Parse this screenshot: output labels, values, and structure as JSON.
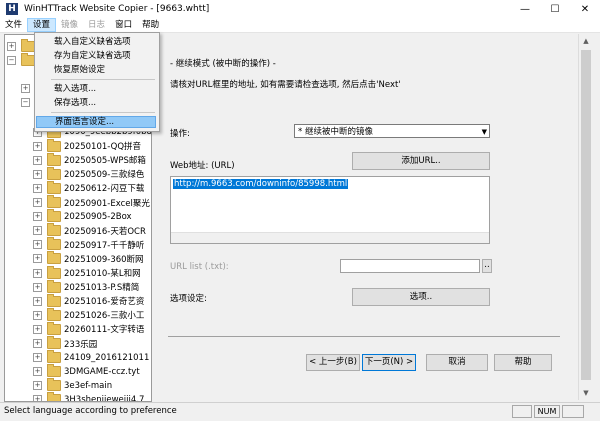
{
  "window": {
    "title": "WinHTTrack Website Copier - [9663.whtt]",
    "app_icon_letter": "H",
    "minimize": "—",
    "maximize": "☐",
    "close": "✕"
  },
  "menubar": {
    "items": [
      "文件",
      "设置",
      "镜像",
      "日志",
      "窗口",
      "帮助"
    ]
  },
  "settings_menu": {
    "items": [
      "载入自定义缺省选项",
      "存为自定义缺省选项",
      "恢复原始设定",
      "载入选项...",
      "保存选项...",
      "界面语言设定..."
    ]
  },
  "tree": {
    "items": [
      "1090_9eebb2b9f0b8",
      "20250101-QQ拼音",
      "20250505-WPS邮箱",
      "20250509-三款绿色",
      "20250612-闪豆下载",
      "20250901-Excel聚光",
      "20250905-2Box",
      "20250916-天若OCR",
      "20250917-千千静听",
      "20251009-360断网",
      "20251010-某L和网",
      "20251013-P.S精简",
      "20251016-爱奇艺资",
      "20251026-三款小工",
      "20260111-文字转语",
      "233乐园",
      "24109_2016121011",
      "3DMGAME-ccz.tyt",
      "3e3ef-main",
      "3H3shenjieweiji4.7"
    ]
  },
  "wizard": {
    "mode_title": "- 继续模式 (被中断的操作) -",
    "instruction": "请核对URL框里的地址, 如有需要请检查选项, 然后点击'Next'",
    "action_label": "操作:",
    "action_value": "* 继续被中断的镜像",
    "web_address_label": "Web地址: (URL)",
    "add_url_button": "添加URL..",
    "url_value": "http://m.9663.com/downinfo/85998.html",
    "url_list_label": "URL list (.txt):",
    "url_list_value": "",
    "browse_button": "..",
    "options_label": "选项设定:",
    "options_button": "选项..",
    "back_button": "< 上一步(B)",
    "next_button": "下一页(N) >",
    "cancel_button": "取消",
    "help_button": "帮助"
  },
  "statusbar": {
    "text": "Select language according to preference",
    "num": "NUM"
  }
}
